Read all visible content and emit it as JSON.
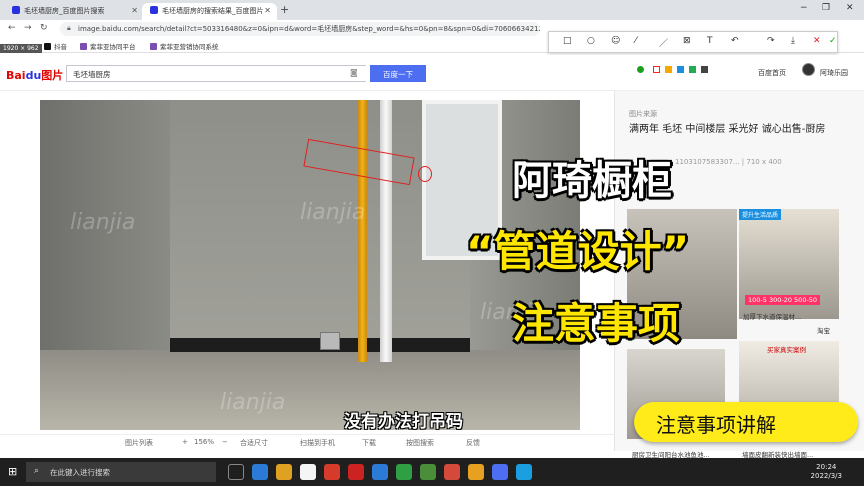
{
  "browser": {
    "tabs": [
      {
        "label": "毛坯墙厨房_百度图片搜索",
        "active": false
      },
      {
        "label": "毛坯墙厨房的搜索结果_百度图片",
        "active": true
      }
    ],
    "new_tab": "+",
    "url": "image.baidu.com/search/detail?ct=503316480&z=0&ipn=d&word=毛坯墙厨房&step_word=&hs=0&pn=8&spn=0&di=706066342128019046&pi=0&rn=1&tn=baiduimagedetail&is=",
    "window_controls": {
      "minimize": "−",
      "maximize": "❐",
      "close": "✕"
    },
    "bookmarks": [
      {
        "label": "抖音",
        "color": "#111111"
      },
      {
        "label": "紫菲亚协同平台",
        "color": "#7a4fb0"
      },
      {
        "label": "紫菲亚营销协同系统",
        "color": "#7a4fb0"
      }
    ],
    "screen_size_badge": "1920 × 962"
  },
  "annotation_toolbar": {
    "tools": [
      "□",
      "○",
      "☺",
      "⁄",
      "／",
      "⊠",
      "T",
      "↶",
      "↷",
      "⤓",
      "✕",
      "✓"
    ]
  },
  "baidu": {
    "logo_left": "Bai",
    "logo_mid": "du",
    "logo_right": "图片",
    "search_value": "毛坯墙厨房",
    "search_button": "百度一下",
    "colors": [
      "#1aa01a",
      "#ff2222",
      "#f7a800",
      "#1a8fe0",
      "#22aa55",
      "#444444"
    ],
    "header_links": {
      "home": "百度首页",
      "user": "阿琦乐园"
    }
  },
  "viewer": {
    "subtitle": "没有办法打吊码",
    "watermarks": [
      "lianjia",
      "lianjia",
      "lianjia",
      "lianjia"
    ],
    "toolbar": {
      "list": "图片列表",
      "zoom_in": "+",
      "zoom": "156%",
      "zoom_out": "−",
      "fit": "合适尺寸",
      "scan": "扫描到手机",
      "download": "下载",
      "similar": "按图搜索",
      "feedback": "反馈"
    }
  },
  "right_panel": {
    "source_label": "图片来源",
    "title": "满两年 毛坯 中间楼层 采光好 诚心出售-厨房",
    "meta": "1103107583307... | 710 x 400",
    "thumbs": [
      {
        "label": "",
        "tag": "提升生活品质"
      },
      {
        "label": "加厚下水道保温材...",
        "tag": "100-5 300-20 500-50",
        "shop": "淘宝"
      },
      {
        "label": "厨房卫生间阳台水池鱼池...",
        "tag": "买家真实案例"
      },
      {
        "label": "墙面皮翻新装快出墙面..."
      }
    ]
  },
  "overlay": {
    "line1": "阿琦橱柜",
    "line2": "“管道设计”",
    "line3": "注意事项",
    "pill": "注意事项讲解"
  },
  "taskbar": {
    "search_placeholder": "在此键入进行搜索",
    "time": "20:24",
    "date": "2022/3/3",
    "apps": [
      "#2b7bd6",
      "#e0a020",
      "#f5f5f5",
      "#d43b2a",
      "#cc2222",
      "#2b7bd6",
      "#2ea043",
      "#4a8e3a",
      "#d44a3a",
      "#e8a020",
      "#4e6ef2",
      "#1aa0e0"
    ]
  }
}
